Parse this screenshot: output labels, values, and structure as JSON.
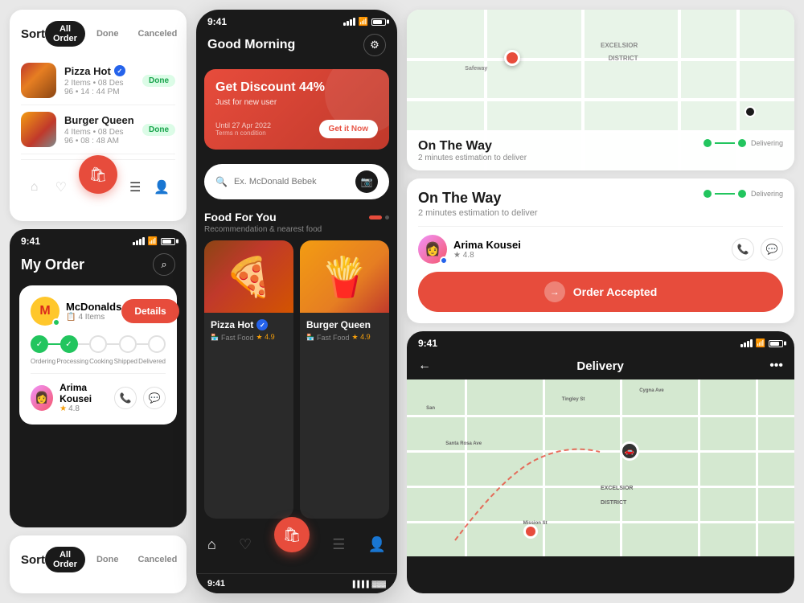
{
  "col1": {
    "sortCard1": {
      "title": "Sort",
      "tabs": [
        "All Order",
        "Done",
        "Canceled"
      ],
      "activeTab": "All Order",
      "orders": [
        {
          "name": "Pizza Hot",
          "verified": true,
          "items": "2 Items",
          "date": "08 Des 96",
          "time": "14 : 44 PM",
          "status": "Done"
        },
        {
          "name": "Burger Queen",
          "verified": false,
          "items": "4 Items",
          "date": "08 Des 96",
          "time": "08 : 48 AM",
          "status": "Done"
        }
      ]
    },
    "myOrderCard": {
      "time": "9:41",
      "title": "My Order",
      "restaurant": "McDonalds",
      "items": "4 Items",
      "detailsBtn": "Details",
      "progressSteps": [
        "Ordering",
        "Processing",
        "Cooking",
        "Shipped",
        "Delivered"
      ],
      "driver": {
        "name": "Arima Kousei",
        "rating": "4.8"
      }
    },
    "sortCard2": {
      "title": "Sort",
      "tabs": [
        "All Order",
        "Done",
        "Canceled"
      ],
      "activeTab": "All Order"
    }
  },
  "col2": {
    "phone": {
      "time": "9:41",
      "greeting": "Good Morning",
      "banner": {
        "discount": "Get Discount 44%",
        "subtitle": "Just for new user",
        "getBtn": "Get it Now",
        "date": "Until 27 Apr 2022",
        "terms": "Terms n condition"
      },
      "search": {
        "placeholder": "Ex. McDonald Bebek"
      },
      "foodSection": {
        "title": "Food For You",
        "subtitle": "Recommendation & nearest food"
      },
      "foods": [
        {
          "name": "Pizza Hot",
          "verified": true,
          "category": "Fast Food",
          "rating": "4.9",
          "emoji": "🍕"
        },
        {
          "name": "Burger Queen",
          "verified": false,
          "category": "Fast Food",
          "rating": "4.9",
          "emoji": "🍟"
        }
      ]
    }
  },
  "col3": {
    "topMapCard": {
      "labels": [
        "EXCELSIOR",
        "DISTRICT",
        "Safeway"
      ],
      "status": "On The Way",
      "eta": "2 minutes estimation to deliver",
      "delivering": "Delivering"
    },
    "onTheWayCard": {
      "title": "On The Way",
      "eta": "2 minutes estimation to deliver",
      "delivering": "Delivering",
      "driver": {
        "name": "Arima Kousei",
        "rating": "4.8"
      },
      "orderAccepted": "Order Accepted"
    },
    "deliveryCard": {
      "time": "9:41",
      "title": "Delivery",
      "backBtn": "←",
      "moreBtn": "•••",
      "mapLabels": [
        "San",
        "Tingley St",
        "Cygna Ave",
        "Santa Rosa Ave",
        "EXCELSIOR",
        "DISTRICT",
        "Mission St"
      ]
    },
    "partialPhone": {
      "time": "9:41"
    }
  }
}
